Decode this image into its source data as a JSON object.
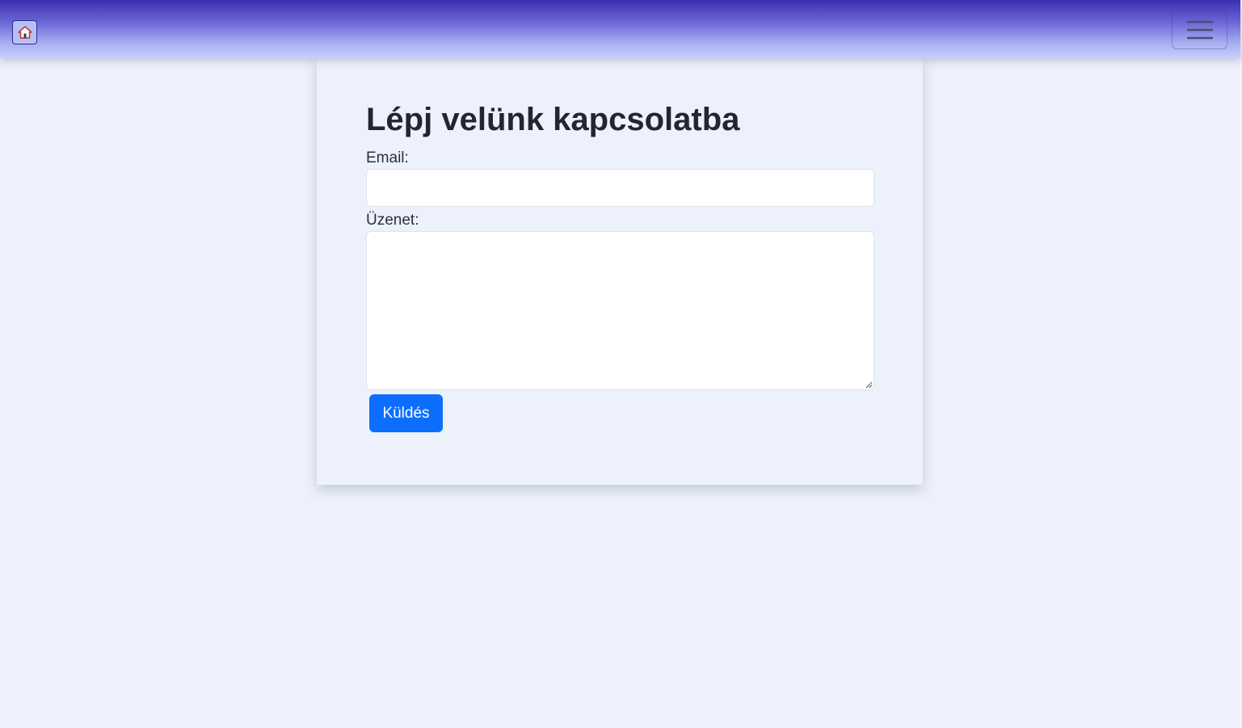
{
  "navbar": {
    "home_icon": "home-icon",
    "menu_icon": "hamburger-menu-icon",
    "gradient_top": "#3d2fb0",
    "gradient_bottom": "#c6cffa"
  },
  "contact": {
    "title": "Lépj velünk kapcsolatba",
    "email_label": "Email:",
    "email_value": "",
    "message_label": "Üzenet:",
    "message_value": "",
    "submit_label": "Küldés"
  },
  "colors": {
    "page_background": "#edf1fc",
    "button_primary": "#0d6efd"
  }
}
